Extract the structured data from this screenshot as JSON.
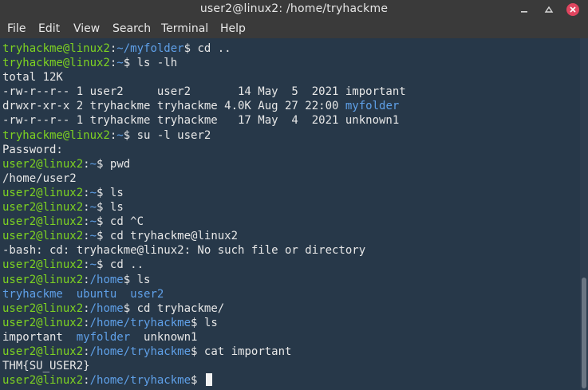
{
  "window": {
    "title": "user2@linux2: /home/tryhackme",
    "controls": [
      "minimize-icon",
      "maximize-icon",
      "close-icon"
    ]
  },
  "menu": [
    "File",
    "Edit",
    "View",
    "Search",
    "Terminal",
    "Help"
  ],
  "colors": {
    "prompt_user_host": "#7ed321",
    "path_and_directories": "#5fa0e8",
    "text": "#e7e7e7",
    "background": "#273849",
    "close_button": "#e0455f"
  },
  "terminal": {
    "lines": [
      [
        {
          "t": "tryhackme@linux2",
          "c": "g"
        },
        {
          "t": ":",
          "c": "w"
        },
        {
          "t": "~/myfolder",
          "c": "b"
        },
        {
          "t": "$ cd ..",
          "c": "w"
        }
      ],
      [
        {
          "t": "tryhackme@linux2",
          "c": "g"
        },
        {
          "t": ":",
          "c": "w"
        },
        {
          "t": "~",
          "c": "b"
        },
        {
          "t": "$ ls -lh",
          "c": "w"
        }
      ],
      [
        {
          "t": "total 12K",
          "c": "w"
        }
      ],
      [
        {
          "t": "-rw-r--r-- 1 user2     user2       14 May  5  2021 important",
          "c": "w"
        }
      ],
      [
        {
          "t": "drwxr-xr-x 2 tryhackme tryhackme 4.0K Aug 27 22:00 ",
          "c": "w"
        },
        {
          "t": "myfolder",
          "c": "b"
        }
      ],
      [
        {
          "t": "-rw-r--r-- 1 tryhackme tryhackme   17 May  4  2021 unknown1",
          "c": "w"
        }
      ],
      [
        {
          "t": "tryhackme@linux2",
          "c": "g"
        },
        {
          "t": ":",
          "c": "w"
        },
        {
          "t": "~",
          "c": "b"
        },
        {
          "t": "$ su -l user2",
          "c": "w"
        }
      ],
      [
        {
          "t": "Password:",
          "c": "w"
        }
      ],
      [
        {
          "t": "user2@linux2",
          "c": "g"
        },
        {
          "t": ":",
          "c": "w"
        },
        {
          "t": "~",
          "c": "b"
        },
        {
          "t": "$ pwd",
          "c": "w"
        }
      ],
      [
        {
          "t": "/home/user2",
          "c": "w"
        }
      ],
      [
        {
          "t": "user2@linux2",
          "c": "g"
        },
        {
          "t": ":",
          "c": "w"
        },
        {
          "t": "~",
          "c": "b"
        },
        {
          "t": "$ ls",
          "c": "w"
        }
      ],
      [
        {
          "t": "user2@linux2",
          "c": "g"
        },
        {
          "t": ":",
          "c": "w"
        },
        {
          "t": "~",
          "c": "b"
        },
        {
          "t": "$ ls",
          "c": "w"
        }
      ],
      [
        {
          "t": "user2@linux2",
          "c": "g"
        },
        {
          "t": ":",
          "c": "w"
        },
        {
          "t": "~",
          "c": "b"
        },
        {
          "t": "$ cd ^C",
          "c": "w"
        }
      ],
      [
        {
          "t": "user2@linux2",
          "c": "g"
        },
        {
          "t": ":",
          "c": "w"
        },
        {
          "t": "~",
          "c": "b"
        },
        {
          "t": "$ cd tryhackme@linux2",
          "c": "w"
        }
      ],
      [
        {
          "t": "-bash: cd: tryhackme@linux2: No such file or directory",
          "c": "w"
        }
      ],
      [
        {
          "t": "user2@linux2",
          "c": "g"
        },
        {
          "t": ":",
          "c": "w"
        },
        {
          "t": "~",
          "c": "b"
        },
        {
          "t": "$ cd ..",
          "c": "w"
        }
      ],
      [
        {
          "t": "user2@linux2",
          "c": "g"
        },
        {
          "t": ":",
          "c": "w"
        },
        {
          "t": "/home",
          "c": "b"
        },
        {
          "t": "$ ls",
          "c": "w"
        }
      ],
      [
        {
          "t": "tryhackme",
          "c": "b"
        },
        {
          "t": "  ",
          "c": "w"
        },
        {
          "t": "ubuntu",
          "c": "b"
        },
        {
          "t": "  ",
          "c": "w"
        },
        {
          "t": "user2",
          "c": "b"
        }
      ],
      [
        {
          "t": "user2@linux2",
          "c": "g"
        },
        {
          "t": ":",
          "c": "w"
        },
        {
          "t": "/home",
          "c": "b"
        },
        {
          "t": "$ cd tryhackme/",
          "c": "w"
        }
      ],
      [
        {
          "t": "user2@linux2",
          "c": "g"
        },
        {
          "t": ":",
          "c": "w"
        },
        {
          "t": "/home/tryhackme",
          "c": "b"
        },
        {
          "t": "$ ls",
          "c": "w"
        }
      ],
      [
        {
          "t": "important  ",
          "c": "w"
        },
        {
          "t": "myfolder",
          "c": "b"
        },
        {
          "t": "  unknown1",
          "c": "w"
        }
      ],
      [
        {
          "t": "user2@linux2",
          "c": "g"
        },
        {
          "t": ":",
          "c": "w"
        },
        {
          "t": "/home/tryhackme",
          "c": "b"
        },
        {
          "t": "$ cat important",
          "c": "w"
        }
      ],
      [
        {
          "t": "THM{SU_USER2}",
          "c": "w"
        }
      ],
      [
        {
          "t": "user2@linux2",
          "c": "g"
        },
        {
          "t": ":",
          "c": "w"
        },
        {
          "t": "/home/tryhackme",
          "c": "b"
        },
        {
          "t": "$ ",
          "c": "w"
        }
      ]
    ]
  }
}
